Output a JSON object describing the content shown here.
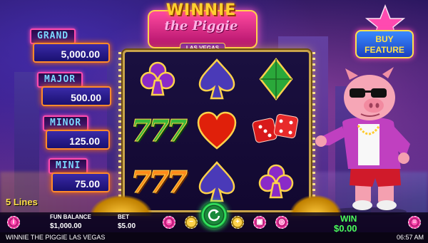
{
  "game": {
    "logo_line1": "WINNIE",
    "logo_line2": "the Piggie",
    "logo_line3": "LAS VEGAS"
  },
  "jackpots": [
    {
      "label": "GRAND",
      "value": "5,000.00"
    },
    {
      "label": "MAJOR",
      "value": "500.00"
    },
    {
      "label": "MINOR",
      "value": "125.00"
    },
    {
      "label": "MINI",
      "value": "75.00"
    }
  ],
  "buy_feature": {
    "line1": "BUY",
    "line2": "FEATURE"
  },
  "reels": [
    [
      "purple-club",
      "blue-spade",
      "green-diamond"
    ],
    [
      "green-777",
      "red-heart",
      "red-dice"
    ],
    [
      "orange-777",
      "blue-spade",
      "purple-club"
    ]
  ],
  "hud": {
    "lines": "5 Lines",
    "balance_label": "FUN BALANCE",
    "balance_value": "$1,000.00",
    "bet_label": "BET",
    "bet_value": "$5.00",
    "win_label": "WIN",
    "win_value": "$0.00"
  },
  "status": {
    "title": "WINNIE THE PIGGIE LAS VEGAS",
    "time": "06:57 AM"
  },
  "colors": {
    "accent_pink": "#ff4ab0",
    "accent_gold": "#ffd24a",
    "win_green": "#4aff5a"
  }
}
